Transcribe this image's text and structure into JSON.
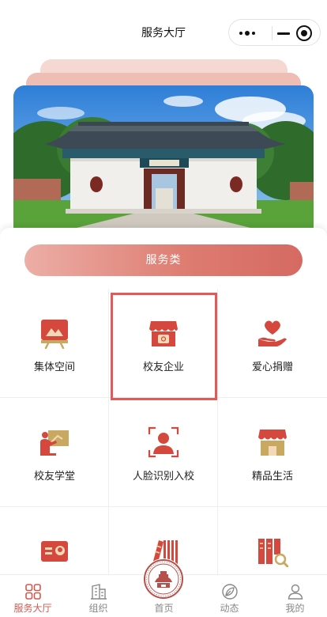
{
  "header": {
    "title": "服务大厅"
  },
  "capsule": {
    "more_icon": "more-dots-icon",
    "minimize_icon": "minimize-icon",
    "close_icon": "close-circle-icon"
  },
  "banner": {
    "image": "school-gate-photo"
  },
  "category": {
    "label": "服务类"
  },
  "services": [
    {
      "label": "集体空间",
      "icon": "photo-frame-icon"
    },
    {
      "label": "校友企业",
      "icon": "storefront-icon"
    },
    {
      "label": "爱心捐赠",
      "icon": "heart-hand-icon"
    },
    {
      "label": "校友学堂",
      "icon": "teacher-board-icon"
    },
    {
      "label": "人脸识别入校",
      "icon": "face-scan-icon"
    },
    {
      "label": "精品生活",
      "icon": "shop-awning-icon"
    },
    {
      "label": "",
      "icon": "id-card-icon"
    },
    {
      "label": "",
      "icon": "books-icon"
    },
    {
      "label": "",
      "icon": "book-search-icon"
    }
  ],
  "tabbar": {
    "items": [
      {
        "label": "服务大厅",
        "icon": "grid-icon",
        "active": true
      },
      {
        "label": "组织",
        "icon": "building-icon",
        "active": false
      },
      {
        "label": "首页",
        "icon": "school-seal-icon",
        "active": false
      },
      {
        "label": "动态",
        "icon": "leaf-icon",
        "active": false
      },
      {
        "label": "我的",
        "icon": "user-icon",
        "active": false
      }
    ]
  },
  "colors": {
    "accent": "#d25a50",
    "icon_red": "#d4483e",
    "icon_gold": "#c9a961",
    "selection": "#e05a5a"
  }
}
